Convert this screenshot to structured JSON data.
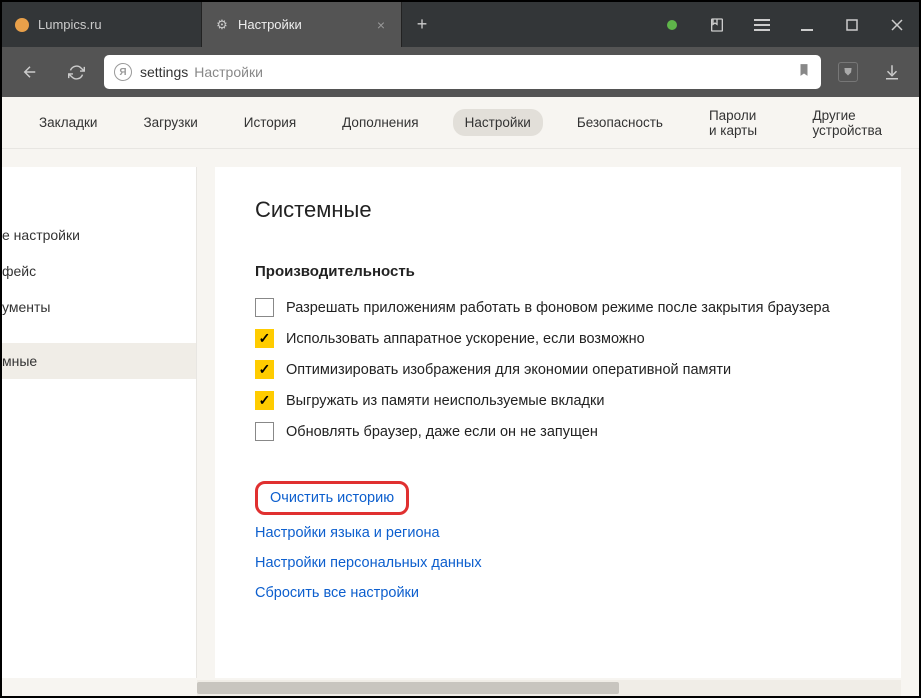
{
  "titlebar": {
    "tabs": [
      {
        "label": "Lumpics.ru",
        "icon": "orange"
      },
      {
        "label": "Настройки",
        "icon": "gear"
      }
    ]
  },
  "toolbar": {
    "address_host": "settings",
    "address_title": "Настройки"
  },
  "menubar": {
    "items": [
      "Закладки",
      "Загрузки",
      "История",
      "Дополнения",
      "Настройки",
      "Безопасность",
      "Пароли и карты",
      "Другие устройства"
    ],
    "active_index": 4
  },
  "sidebar": {
    "items": [
      "е настройки",
      "фейс",
      "ументы",
      "мные"
    ],
    "active_index": 3
  },
  "main": {
    "section_title": "Системные",
    "subsection": "Производительность",
    "checks": [
      {
        "label": "Разрешать приложениям работать в фоновом режиме после закрытия браузера",
        "checked": false
      },
      {
        "label": "Использовать аппаратное ускорение, если возможно",
        "checked": true
      },
      {
        "label": "Оптимизировать изображения для экономии оперативной памяти",
        "checked": true
      },
      {
        "label": "Выгружать из памяти неиспользуемые вкладки",
        "checked": true
      },
      {
        "label": "Обновлять браузер, даже если он не запущен",
        "checked": false
      }
    ],
    "links": [
      "Очистить историю",
      "Настройки языка и региона",
      "Настройки персональных данных",
      "Сбросить все настройки"
    ],
    "highlighted_link_index": 0
  }
}
